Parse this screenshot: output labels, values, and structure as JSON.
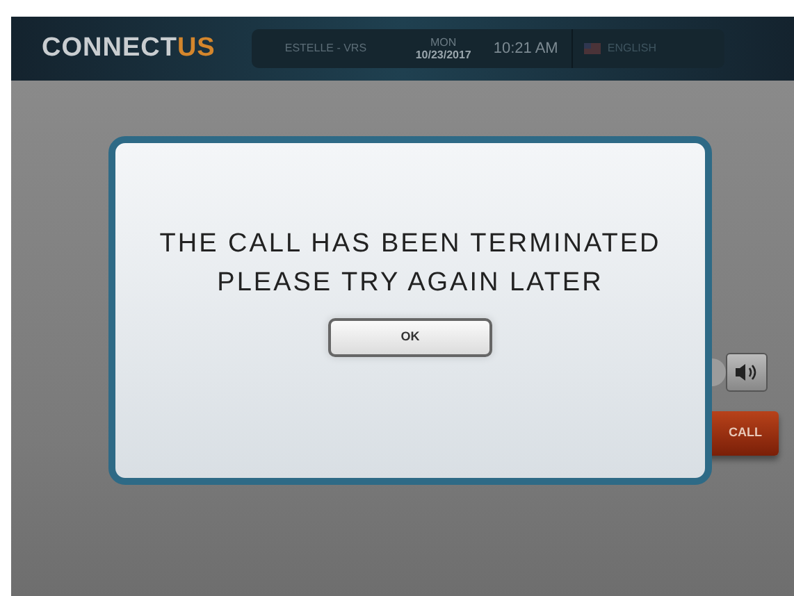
{
  "header": {
    "logo": {
      "main": "CONNECT",
      "accent": "US"
    },
    "user": "ESTELLE - VRS",
    "day": "MON",
    "date": "10/23/2017",
    "time": "10:21 AM",
    "language": "ENGLISH"
  },
  "background_controls": {
    "call_button": "CALL"
  },
  "dialog": {
    "lines": [
      "THE CALL HAS BEEN TERMINATED",
      "PLEASE TRY AGAIN LATER"
    ],
    "button": "OK"
  }
}
